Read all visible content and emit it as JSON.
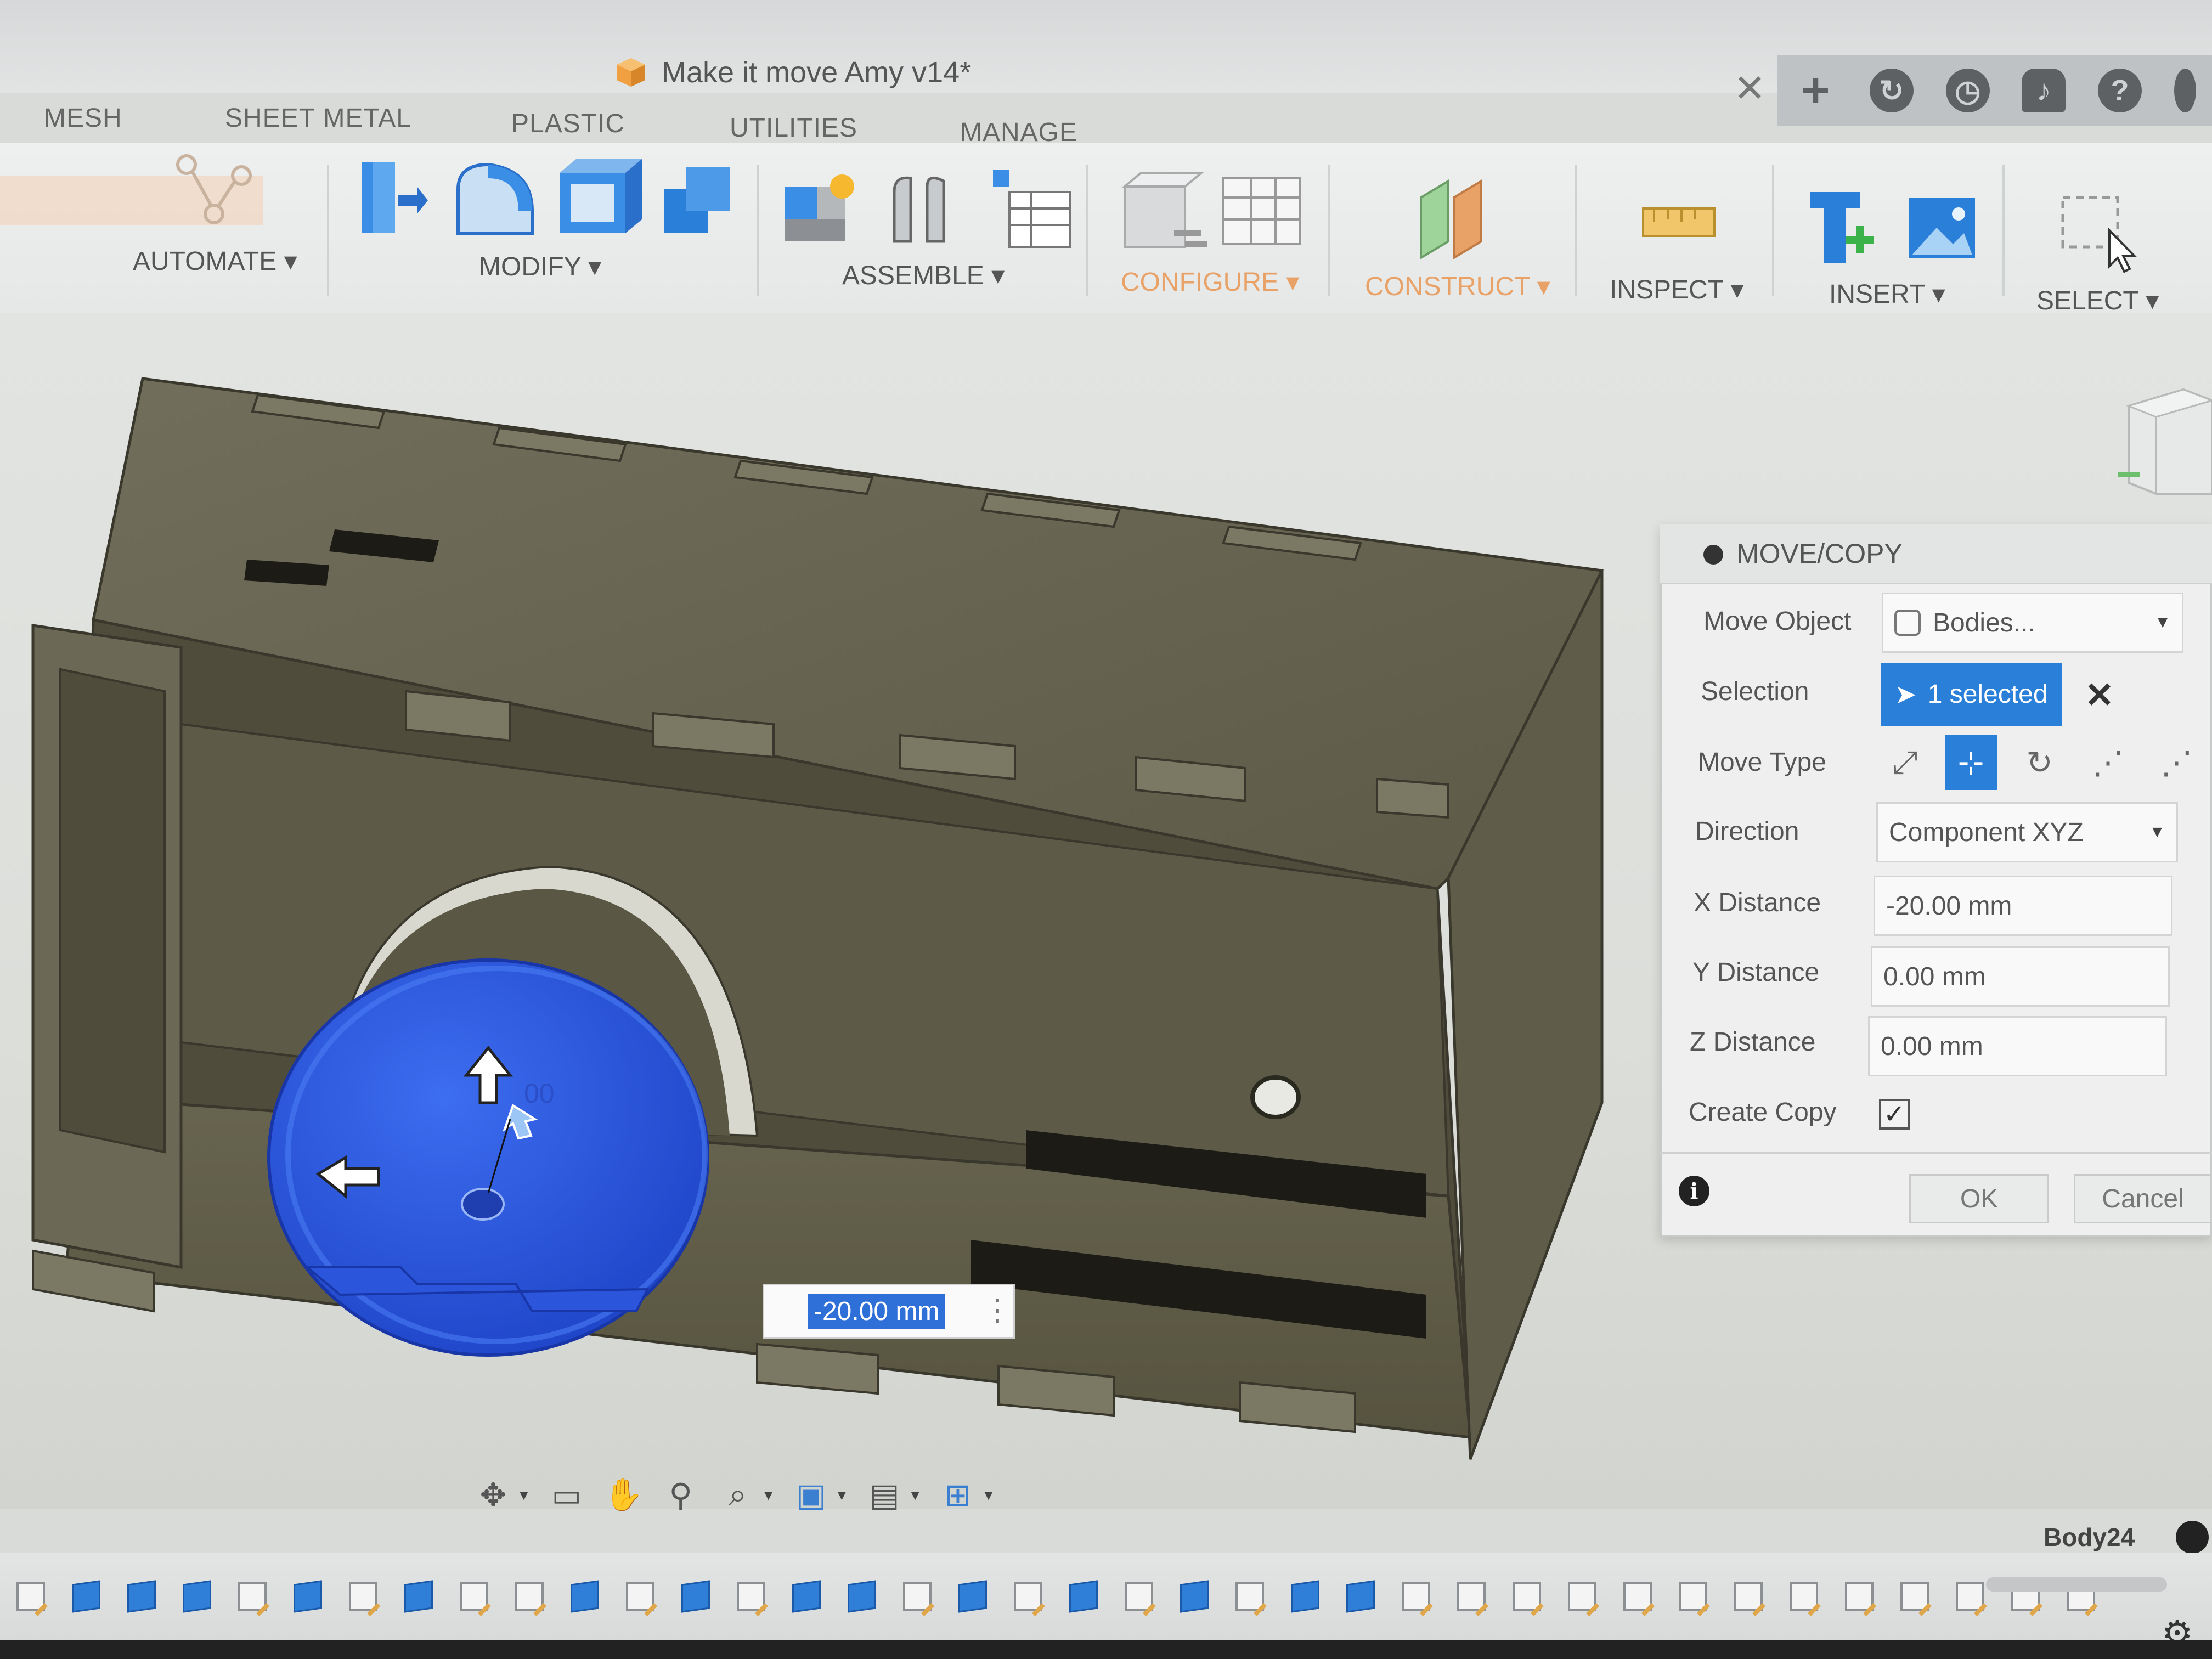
{
  "window": {
    "document_title": "Make it move Amy v14*",
    "close_glyph": "✕"
  },
  "workspace_tabs": [
    "MESH",
    "SHEET METAL",
    "PLASTIC",
    "UTILITIES",
    "MANAGE"
  ],
  "toolbar": {
    "groups": [
      {
        "label": "AUTOMATE ▾",
        "icons": [
          "automate-icon"
        ]
      },
      {
        "label": "MODIFY ▾",
        "icons": [
          "press-pull-icon",
          "fillet-icon",
          "shell-icon",
          "combine-icon"
        ]
      },
      {
        "label": "ASSEMBLE ▾",
        "icons": [
          "new-component-icon",
          "joint-icon",
          "bill-of-materials-icon"
        ]
      },
      {
        "label": "CONFIGURE ▾",
        "icons": [
          "configure-icon",
          "configuration-table-icon"
        ]
      },
      {
        "label": "CONSTRUCT ▾",
        "icons": [
          "construct-plane-icon"
        ]
      },
      {
        "label": "INSPECT ▾",
        "icons": [
          "measure-icon"
        ]
      },
      {
        "label": "INSERT ▾",
        "icons": [
          "insert-derive-icon",
          "insert-image-icon"
        ]
      },
      {
        "label": "SELECT ▾",
        "icons": [
          "select-icon"
        ]
      }
    ]
  },
  "viewport": {
    "dimension_input_value": "-20.00 mm",
    "manipulator_label": "00"
  },
  "move_copy_dialog": {
    "title": "MOVE/COPY",
    "move_object_label": "Move Object",
    "move_object_value": "Bodies...",
    "selection_label": "Selection",
    "selection_value": "1 selected",
    "selection_clear": "✕",
    "move_type_label": "Move Type",
    "move_types": [
      "free-move-icon",
      "translate-xyz-icon",
      "rotate-icon",
      "point-to-point-icon",
      "point-to-position-icon"
    ],
    "direction_label": "Direction",
    "direction_value": "Component XYZ",
    "x_label": "X Distance",
    "x_value": "-20.00 mm",
    "y_label": "Y Distance",
    "y_value": "0.00 mm",
    "z_label": "Z Distance",
    "z_value": "0.00 mm",
    "create_copy_label": "Create Copy",
    "create_copy_checked": true,
    "ok_label": "OK",
    "cancel_label": "Cancel"
  },
  "status": {
    "body_name": "Body24"
  },
  "timeline": {
    "items": [
      "sketch",
      "body",
      "body",
      "body",
      "sketch",
      "body",
      "sketch",
      "body",
      "sketch",
      "sketch",
      "body",
      "sketch",
      "body",
      "sketch",
      "body",
      "body",
      "sketch",
      "body",
      "sketch",
      "body",
      "sketch",
      "body",
      "sketch",
      "body",
      "body",
      "sketch",
      "sketch",
      "sketch",
      "sketch",
      "sketch",
      "sketch",
      "sketch",
      "sketch",
      "sketch",
      "sketch",
      "sketch",
      "sketch",
      "sketch"
    ]
  },
  "colors": {
    "selection_blue": "#2a7fd9",
    "model_body": "#6d6a57",
    "selected_body": "#2f5fe0",
    "construct_orange": "#e8a268"
  }
}
